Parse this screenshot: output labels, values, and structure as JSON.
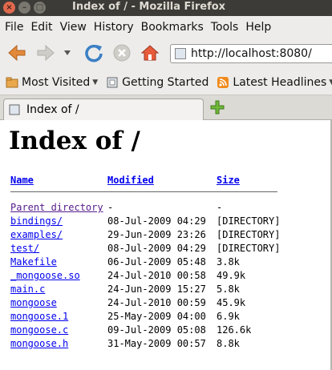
{
  "window": {
    "title": "Index of / - Mozilla Firefox",
    "buttons": [
      "×",
      "–",
      "□"
    ]
  },
  "menu": [
    "File",
    "Edit",
    "View",
    "History",
    "Bookmarks",
    "Tools",
    "Help"
  ],
  "navbar": {
    "url": "http://localhost:8080/",
    "icons": [
      "back-icon",
      "forward-icon",
      "history-dropdown-icon",
      "reload-icon",
      "stop-icon",
      "home-icon",
      "site-icon"
    ]
  },
  "bookmarks": {
    "items": [
      {
        "label": "Most Visited",
        "icon": "star-folder-icon"
      },
      {
        "label": "Getting Started",
        "icon": "page-icon"
      },
      {
        "label": "Latest Headlines",
        "icon": "rss-icon"
      }
    ]
  },
  "tab": {
    "label": "Index of /"
  },
  "page": {
    "heading": "Index of /",
    "columns": {
      "name": "Name",
      "modified": "Modified",
      "size": "Size"
    },
    "parent": {
      "name": "Parent directory",
      "modified": "-",
      "size": "-"
    },
    "files": [
      {
        "name": "bindings/",
        "modified": "08-Jul-2009 04:29",
        "size": "[DIRECTORY]"
      },
      {
        "name": "examples/",
        "modified": "29-Jun-2009 23:26",
        "size": "[DIRECTORY]"
      },
      {
        "name": "test/",
        "modified": "08-Jul-2009 04:29",
        "size": "[DIRECTORY]"
      },
      {
        "name": "Makefile",
        "modified": "06-Jul-2009 05:48",
        "size": "3.8k"
      },
      {
        "name": "_mongoose.so",
        "modified": "24-Jul-2010 00:58",
        "size": "49.9k"
      },
      {
        "name": "main.c",
        "modified": "24-Jun-2009 15:27",
        "size": "5.8k"
      },
      {
        "name": "mongoose",
        "modified": "24-Jul-2010 00:59",
        "size": "45.9k"
      },
      {
        "name": "mongoose.1",
        "modified": "25-May-2009 04:00",
        "size": "6.9k"
      },
      {
        "name": "mongoose.c",
        "modified": "09-Jul-2009 05:08",
        "size": "126.6k"
      },
      {
        "name": "mongoose.h",
        "modified": "31-May-2009 00:57",
        "size": "8.8k"
      }
    ]
  }
}
